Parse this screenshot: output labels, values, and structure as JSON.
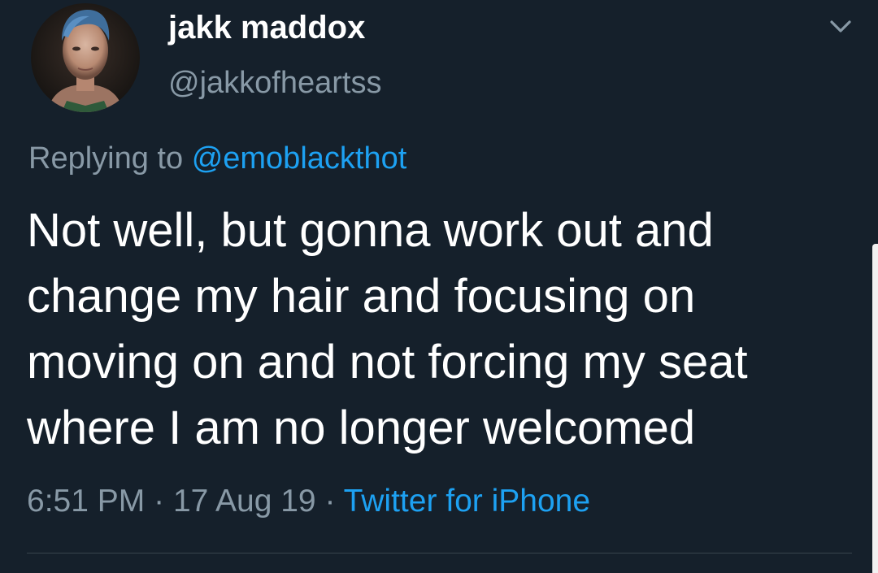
{
  "tweet": {
    "display_name": "jakk maddox",
    "handle": "@jakkofheartss",
    "replying_to_label": "Replying to",
    "replying_to_handle": "@emoblackthot",
    "text_lines": [
      "Not well, but gonna work out and",
      "change my hair and focusing on",
      "moving on and not forcing my seat",
      "where I am no longer welcomed"
    ],
    "time": "6:51 PM",
    "separator": "·",
    "date": "17 Aug 19",
    "source": "Twitter for iPhone"
  },
  "icons": {
    "menu": "chevron-down-icon",
    "avatar": "profile-photo"
  },
  "colors": {
    "background": "#15202b",
    "primary_text": "#ffffff",
    "secondary_text": "#8899a6",
    "accent": "#1da1f2",
    "divider": "#38444d"
  }
}
